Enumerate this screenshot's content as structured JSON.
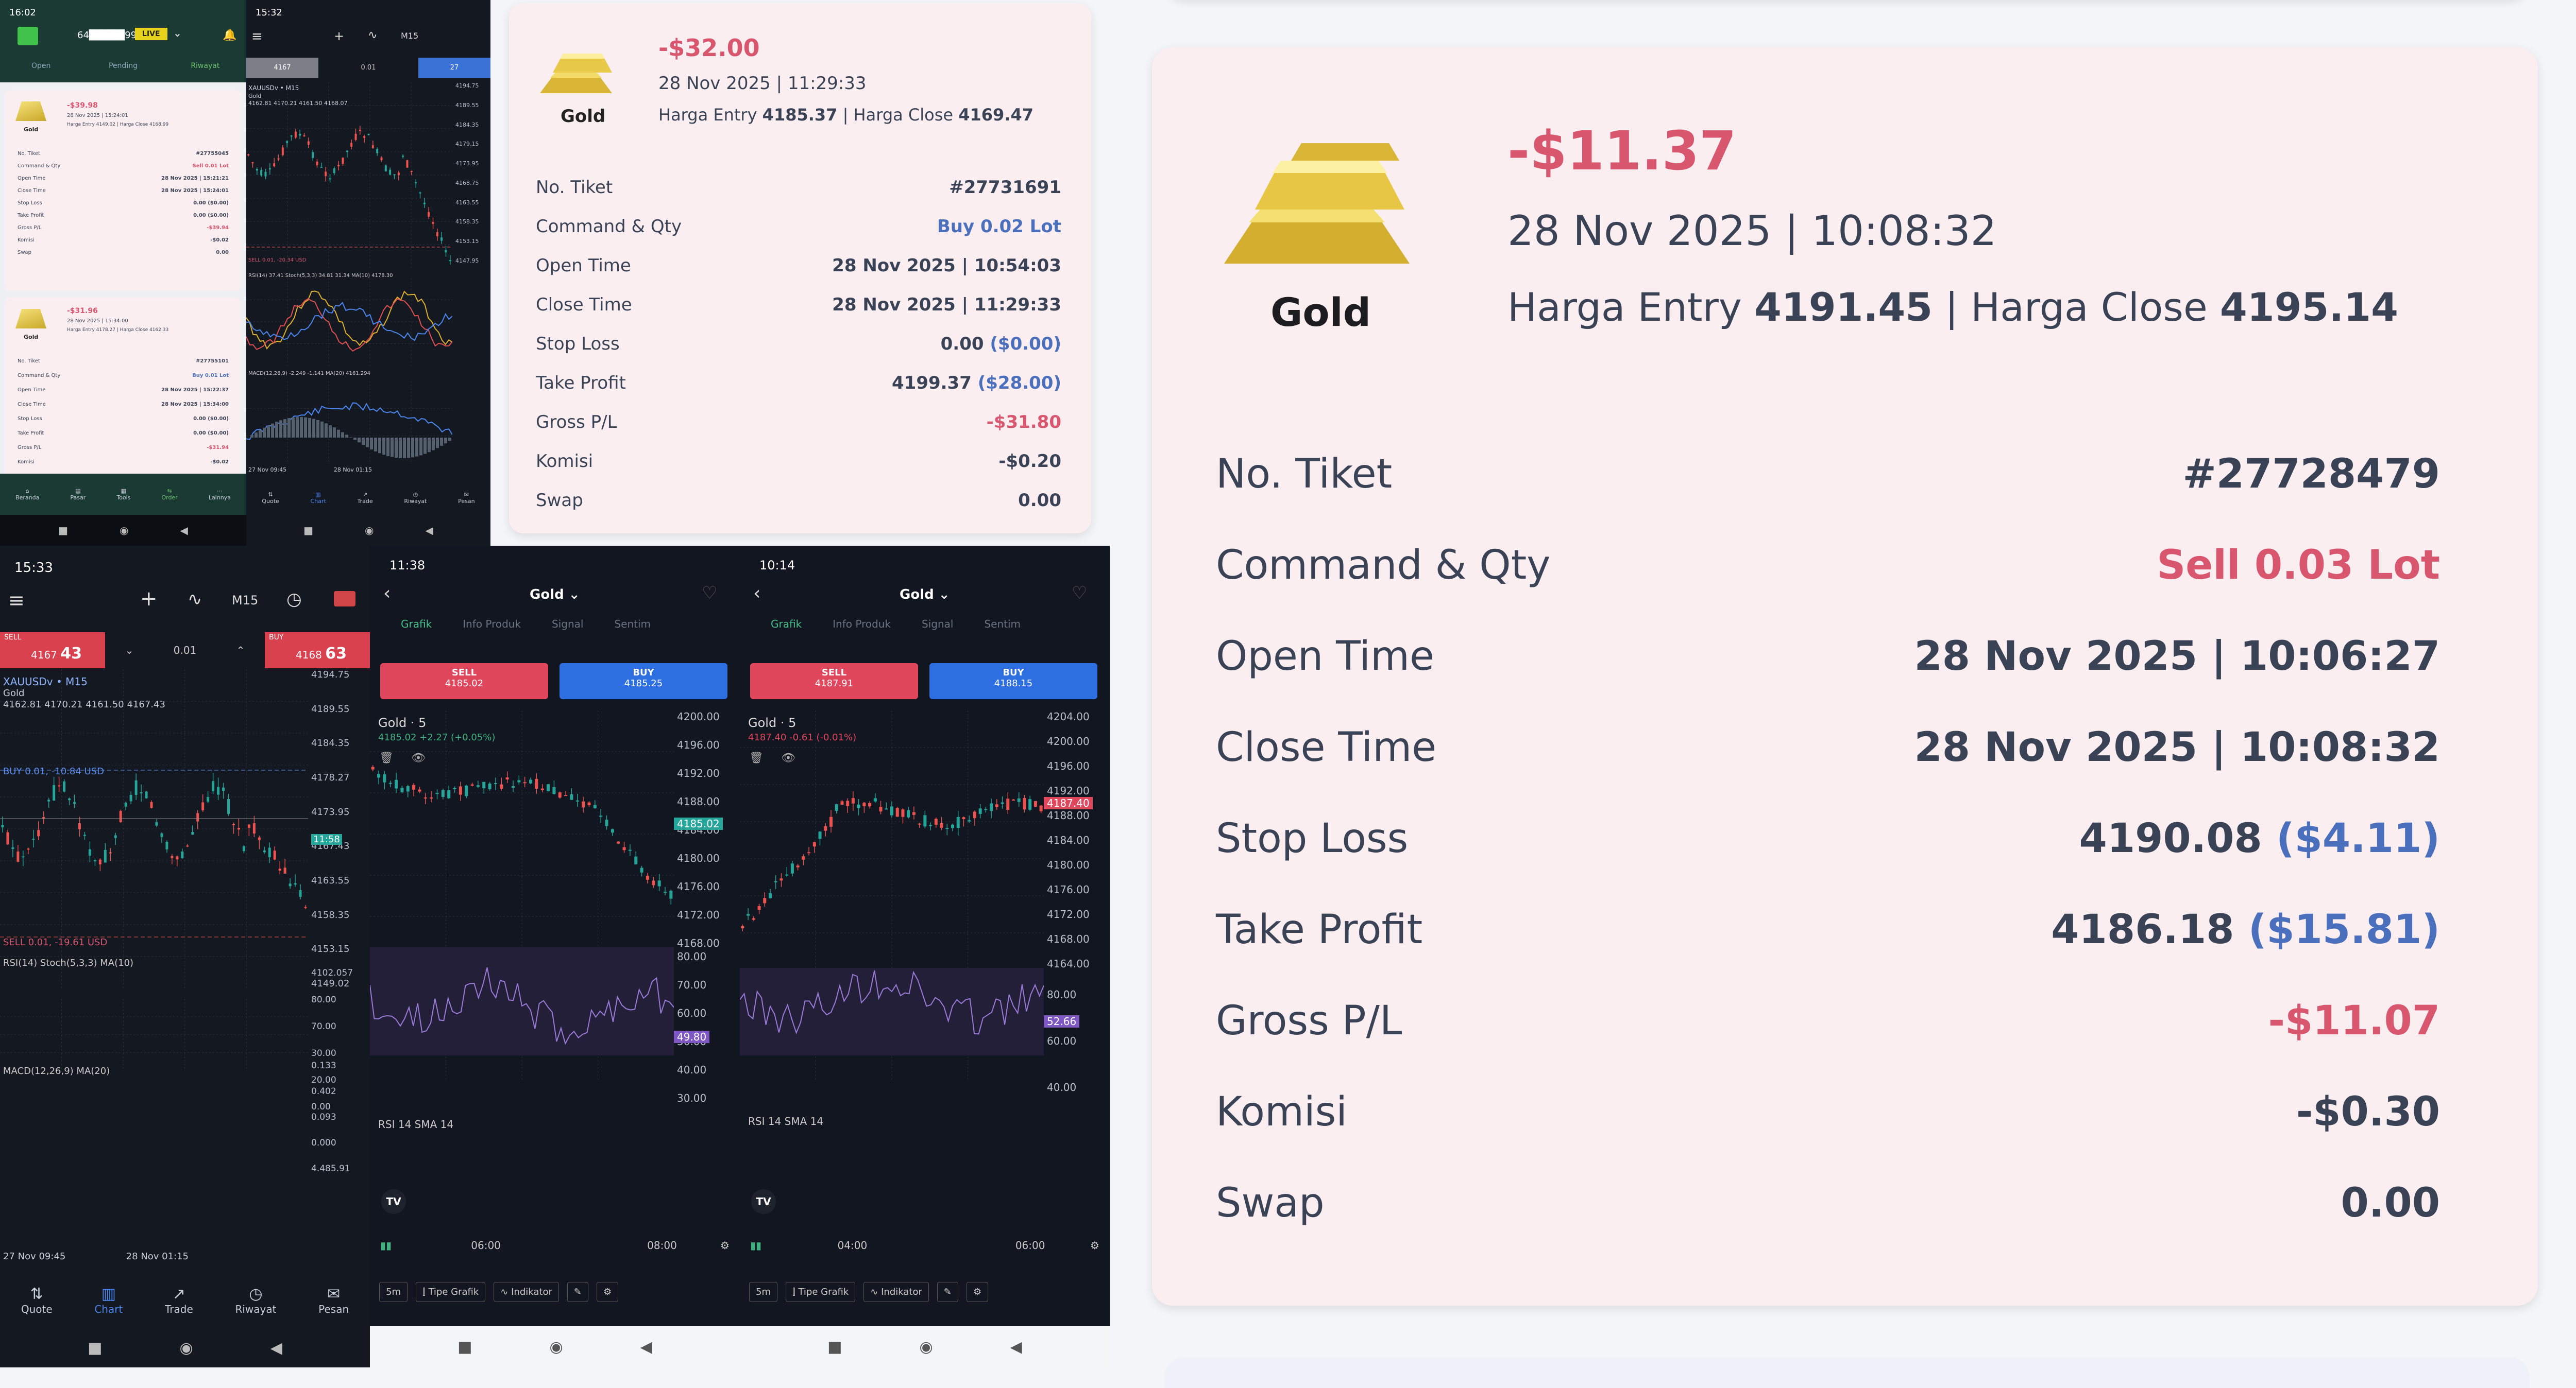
{
  "main_card": {
    "pl": "-$11.37",
    "datetime": "28 Nov 2025 | 10:08:32",
    "asset": "Gold",
    "entry_label": "Harga Entry",
    "entry_value": "4191.45",
    "separator": "|",
    "close_label": "Harga Close",
    "close_value": "4195.14",
    "rows": [
      {
        "label": "No. Tiket",
        "value": "#27728479"
      },
      {
        "label": "Command & Qty",
        "value": "Sell 0.03 Lot"
      },
      {
        "label": "Open Time",
        "value": "28 Nov 2025 | 10:06:27"
      },
      {
        "label": "Close Time",
        "value": "28 Nov 2025 | 10:08:32"
      },
      {
        "label": "Stop Loss",
        "value": "4190.08",
        "extra": "($4.11)"
      },
      {
        "label": "Take Profit",
        "value": "4186.18",
        "extra": "($15.81)"
      },
      {
        "label": "Gross P/L",
        "value": "-$11.07"
      },
      {
        "label": "Komisi",
        "value": "-$0.30"
      },
      {
        "label": "Swap",
        "value": "0.00"
      }
    ]
  },
  "mid_card": {
    "pl": "-$32.00",
    "datetime": "28 Nov 2025 | 11:29:33",
    "asset": "Gold",
    "entry_label": "Harga Entry",
    "entry_value": "4185.37",
    "separator": "|",
    "close_label": "Harga Close",
    "close_value": "4169.47",
    "rows": [
      {
        "label": "No. Tiket",
        "value": "#27731691"
      },
      {
        "label": "Command & Qty",
        "value": "Buy 0.02 Lot"
      },
      {
        "label": "Open Time",
        "value": "28 Nov 2025 | 10:54:03"
      },
      {
        "label": "Close Time",
        "value": "28 Nov 2025 | 11:29:33"
      },
      {
        "label": "Stop Loss",
        "value": "0.00",
        "extra": "($0.00)"
      },
      {
        "label": "Take Profit",
        "value": "4199.37",
        "extra": "($28.00)"
      },
      {
        "label": "Gross P/L",
        "value": "-$31.80"
      },
      {
        "label": "Komisi",
        "value": "-$0.20"
      },
      {
        "label": "Swap",
        "value": "0.00"
      }
    ]
  },
  "phone_history": {
    "time": "16:02",
    "live_badge": "LIVE",
    "account": "64█████992",
    "tabs": [
      "Open",
      "Pending",
      "Riwayat"
    ],
    "card1": {
      "pl": "-$39.98",
      "date": "28 Nov 2025 | 15:24:01",
      "asset": "Gold",
      "line": "Harga Entry 4149.02 | Harga Close 4168.99",
      "rows": [
        [
          "No. Tiket",
          "#27755045"
        ],
        [
          "Command & Qty",
          "Sell 0.01 Lot"
        ],
        [
          "Open Time",
          "28 Nov 2025 | 15:21:21"
        ],
        [
          "Close Time",
          "28 Nov 2025 | 15:24:01"
        ],
        [
          "Stop Loss",
          "0.00 ($0.00)"
        ],
        [
          "Take Profit",
          "0.00 ($0.00)"
        ],
        [
          "Gross P/L",
          "-$39.94"
        ],
        [
          "Komisi",
          "-$0.02"
        ],
        [
          "Swap",
          "0.00"
        ]
      ]
    },
    "card2": {
      "pl": "-$31.96",
      "date": "28 Nov 2025 | 15:34:00",
      "asset": "Gold",
      "line": "Harga Entry 4178.27 | Harga Close 4162.33",
      "rows": [
        [
          "No. Tiket",
          "#27755101"
        ],
        [
          "Command & Qty",
          "Buy 0.01 Lot"
        ],
        [
          "Open Time",
          "28 Nov 2025 | 15:22:37"
        ],
        [
          "Close Time",
          "28 Nov 2025 | 15:34:00"
        ],
        [
          "Stop Loss",
          "0.00 ($0.00)"
        ],
        [
          "Take Profit",
          "0.00 ($0.00)"
        ],
        [
          "Gross P/L",
          "-$31.94"
        ],
        [
          "Komisi",
          "-$0.02"
        ]
      ]
    },
    "bottom_nav": [
      "Beranda",
      "Pasar",
      "Tools",
      "Order",
      "Lainnya"
    ]
  },
  "phone_chart_small": {
    "time": "15:32",
    "symbol": "XAUUSDv • M15",
    "name": "Gold",
    "ohlc": "4162.81 4170.21 4161.50 4168.07",
    "sell_price": "4167",
    "lot": "0.01",
    "buy_price": "27",
    "prices": [
      "4194.75",
      "4189.55",
      "4184.35",
      "4179.15",
      "4173.95",
      "4168.75",
      "4163.55",
      "4158.35",
      "4153.15",
      "4147.95"
    ],
    "sell_line": "SELL 0.01, -20.34 USD",
    "rsi_label": "RSI(14) 37.41 Stoch(5,3,3) 34.81 31.34 MA(10) 4178.30",
    "macd_label": "MACD(12,26,9) -2.249 -1.141 MA(20) 4161.294",
    "dates": [
      "27 Nov 09:45",
      "28 Nov 01:15"
    ],
    "nav": [
      "Quote",
      "Chart",
      "Trade",
      "Riwayat",
      "Pesan"
    ]
  },
  "phone_chart_large": {
    "time": "15:33",
    "tf": "M15",
    "sell_label": "SELL",
    "sell_price_a": "4167",
    "sell_price_b": "43",
    "lot": "0.01",
    "buy_label": "BUY",
    "buy_price_a": "4168",
    "buy_price_b": "63",
    "symbol": "XAUUSDv • M15",
    "name": "Gold",
    "ohlc": "4162.81 4170.21 4161.50 4167.43",
    "prices": [
      "4194.75",
      "4189.55",
      "4184.35",
      "4178.27",
      "4173.95",
      "4167.43",
      "4163.55",
      "4158.35",
      "4153.15",
      "4149.02"
    ],
    "price_tag_b": "11:58",
    "buy_line": "BUY 0.01, -10.84 USD",
    "sell_line": "SELL 0.01, -19.61 USD",
    "ind1": "RSI(14) Stoch(5,3,3) MA(10)",
    "ind1_vals": [
      "4102.057",
      "80.00",
      "70.00",
      "30.00",
      "20.00",
      "0.00"
    ],
    "ind2": "MACD(12,26,9) MA(20)",
    "ind2_vals": [
      "0.133",
      "0.402",
      "0.093",
      "0.000",
      "4.485.91"
    ],
    "dates": [
      "27 Nov 09:45",
      "28 Nov 01:15"
    ],
    "nav": [
      "Quote",
      "Chart",
      "Trade",
      "Riwayat",
      "Pesan"
    ]
  },
  "tv_a": {
    "time": "11:38",
    "title": "Gold",
    "tabs": [
      "Grafik",
      "Info Produk",
      "Signal",
      "Sentim"
    ],
    "sell_label": "SELL",
    "sell_price": "4185.02",
    "buy_label": "BUY",
    "buy_price": "4185.25",
    "legend": "Gold · 5",
    "change": "4185.02 +2.27 (+0.05%)",
    "prices": [
      "4200.00",
      "4196.00",
      "4192.00",
      "4188.00",
      "4184.00",
      "4180.00",
      "4176.00",
      "4172.00",
      "4168.00"
    ],
    "last": "4185.02",
    "rsi_label": "RSI 14 SMA 14",
    "rsi_levels": [
      "80.00",
      "70.00",
      "60.00",
      "50.00",
      "40.00",
      "30.00"
    ],
    "rsi_last": "49.80",
    "times": [
      "06:00",
      "08:00"
    ],
    "tools": [
      "5m",
      "Tipe Grafik",
      "Indikator"
    ]
  },
  "tv_b": {
    "time": "10:14",
    "title": "Gold",
    "tabs": [
      "Grafik",
      "Info Produk",
      "Signal",
      "Sentim"
    ],
    "sell_label": "SELL",
    "sell_price": "4187.91",
    "buy_label": "BUY",
    "buy_price": "4188.15",
    "legend": "Gold · 5",
    "change": "4187.40 -0.61 (-0.01%)",
    "prices": [
      "4204.00",
      "4200.00",
      "4196.00",
      "4192.00",
      "4188.00",
      "4184.00",
      "4180.00",
      "4176.00",
      "4172.00",
      "4168.00",
      "4164.00"
    ],
    "last": "4187.40",
    "rsi_label": "RSI 14 SMA 14",
    "rsi_levels": [
      "80.00",
      "60.00",
      "40.00"
    ],
    "rsi_last": "52.66",
    "times": [
      "04:00",
      "06:00"
    ],
    "tools": [
      "5m",
      "Tipe Grafik",
      "Indikator"
    ]
  }
}
